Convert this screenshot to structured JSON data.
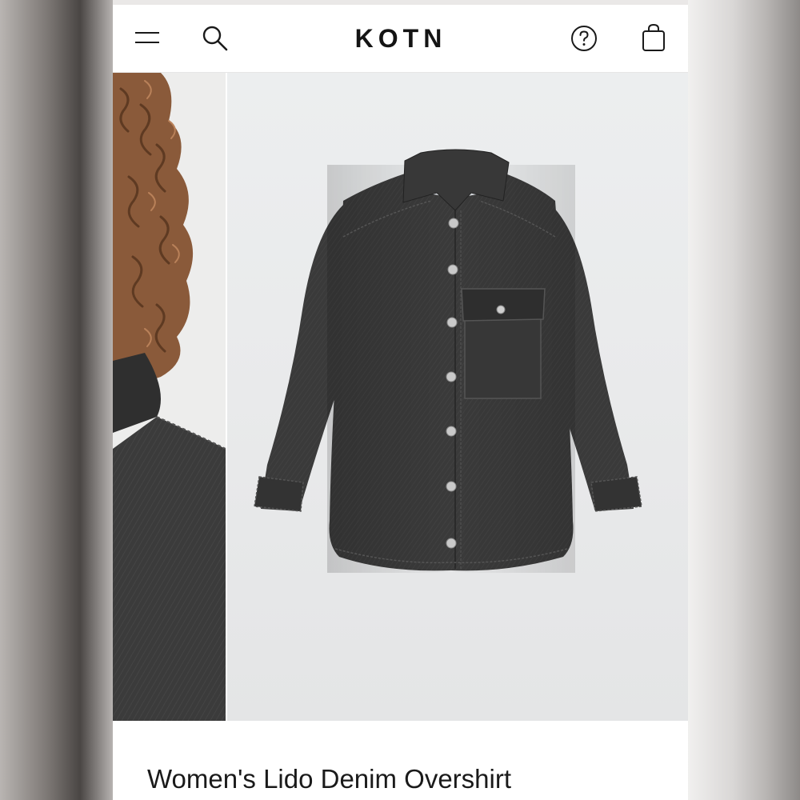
{
  "header": {
    "brand": "KOTN",
    "icons": [
      "menu-icon",
      "search-icon",
      "help-icon",
      "bag-icon"
    ]
  },
  "gallery": {
    "images": [
      "model-collar-closeup",
      "denim-overshirt-flatlay"
    ]
  },
  "product": {
    "title": "Women's Lido Denim Overshirt"
  },
  "colors": {
    "background": "#ffffff",
    "text": "#1a1a1a",
    "denim": "#3a3a3a",
    "image_bg": "#e9eaeb"
  }
}
